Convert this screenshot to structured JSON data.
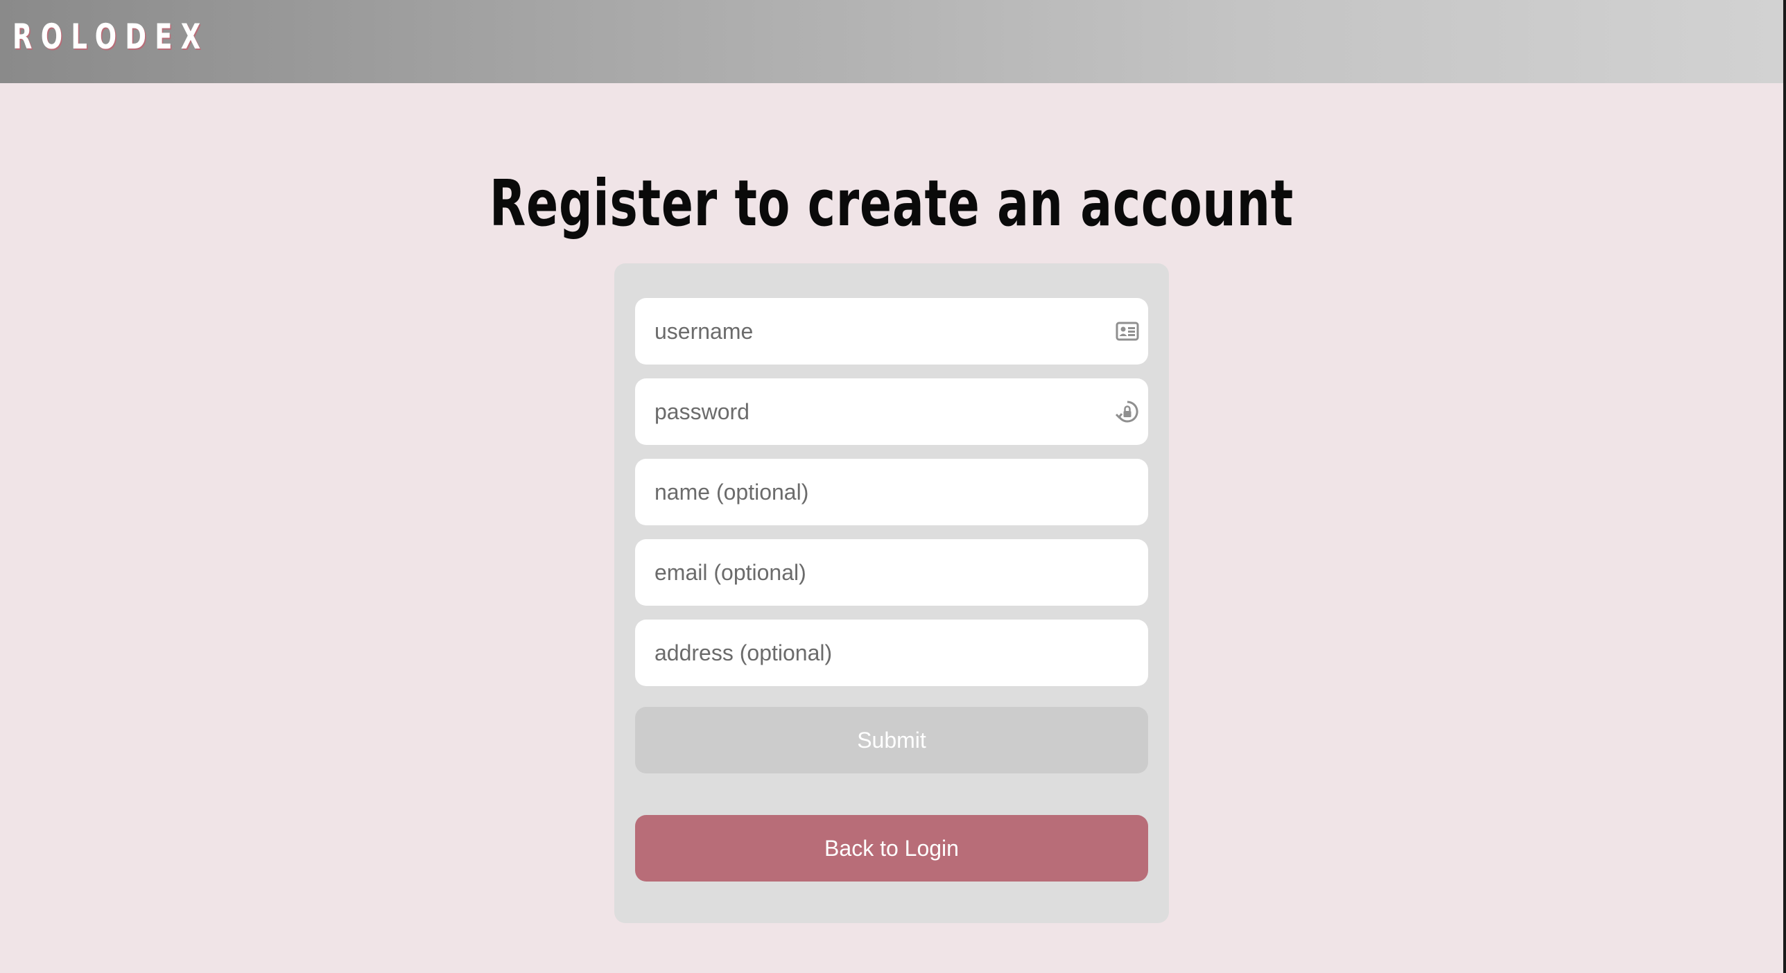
{
  "header": {
    "brand": "ROLODEX"
  },
  "main": {
    "title": "Register to create an account"
  },
  "form": {
    "fields": [
      {
        "placeholder": "username",
        "value": "",
        "icon": "contact-card-icon"
      },
      {
        "placeholder": "password",
        "value": "",
        "icon": "password-key-icon"
      },
      {
        "placeholder": "name (optional)",
        "value": ""
      },
      {
        "placeholder": "email (optional)",
        "value": ""
      },
      {
        "placeholder": "address (optional)",
        "value": ""
      }
    ],
    "submit_label": "Submit",
    "back_label": "Back to Login"
  },
  "colors": {
    "page_background": "#f0e4e7",
    "card_background": "#dddddd",
    "submit_disabled": "#cccccc",
    "accent": "#b86d78",
    "header_gradient_start": "#8a8a8a",
    "header_gradient_end": "#d2d2d2"
  }
}
